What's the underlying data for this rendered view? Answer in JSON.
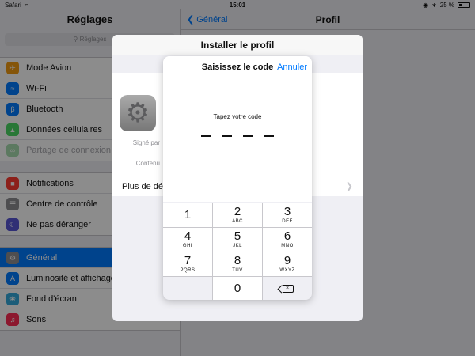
{
  "status_bar": {
    "carrier": "Safari",
    "time": "15:01",
    "battery": "25 %"
  },
  "settings": {
    "title": "Réglages",
    "search_placeholder": "Réglages",
    "group1": [
      {
        "label": "Mode Avion",
        "icon": "airplane-icon",
        "color": "#f39c12"
      },
      {
        "label": "Wi-Fi",
        "icon": "wifi-icon",
        "color": "#007aff"
      },
      {
        "label": "Bluetooth",
        "icon": "bluetooth-icon",
        "color": "#007aff"
      },
      {
        "label": "Données cellulaires",
        "icon": "cellular-icon",
        "color": "#4cd964"
      },
      {
        "label": "Partage de connexion",
        "icon": "hotspot-icon",
        "color": "#4cd964"
      }
    ],
    "group2": [
      {
        "label": "Notifications",
        "icon": "notifications-icon",
        "color": "#ff3b30"
      },
      {
        "label": "Centre de contrôle",
        "icon": "control-center-icon",
        "color": "#8e8e93"
      },
      {
        "label": "Ne pas déranger",
        "icon": "moon-icon",
        "color": "#5856d6"
      }
    ],
    "group3": [
      {
        "label": "Général",
        "icon": "gear-icon",
        "color": "#8e8e93"
      },
      {
        "label": "Luminosité et affichage",
        "icon": "brightness-icon",
        "color": "#007aff"
      },
      {
        "label": "Fond d'écran",
        "icon": "wallpaper-icon",
        "color": "#34aadc"
      },
      {
        "label": "Sons",
        "icon": "sounds-icon",
        "color": "#ff2d55"
      }
    ]
  },
  "detail": {
    "back_label": "Général",
    "title": "Profil"
  },
  "install_sheet": {
    "title": "Installer le profil",
    "signed_by_label": "Signé par",
    "contains_label": "Contenu",
    "more_details": "Plus de déta"
  },
  "passcode_dialog": {
    "title": "Saisissez le code",
    "cancel_label": "Annuler",
    "prompt": "Tapez votre code",
    "keys": [
      {
        "num": "1",
        "letters": ""
      },
      {
        "num": "2",
        "letters": "ABC"
      },
      {
        "num": "3",
        "letters": "DEF"
      },
      {
        "num": "4",
        "letters": "GHI"
      },
      {
        "num": "5",
        "letters": "JKL"
      },
      {
        "num": "6",
        "letters": "MNO"
      },
      {
        "num": "7",
        "letters": "PQRS"
      },
      {
        "num": "8",
        "letters": "TUV"
      },
      {
        "num": "9",
        "letters": "WXYZ"
      },
      {
        "num": "0",
        "letters": ""
      }
    ]
  }
}
